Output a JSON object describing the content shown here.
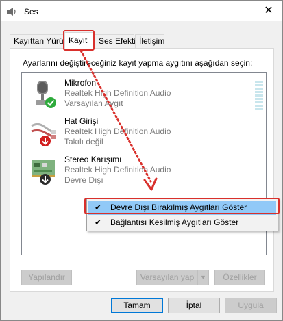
{
  "window": {
    "title": "Ses",
    "close_glyph": "✕"
  },
  "tabs": [
    {
      "label": "Kayıttan Yürüt"
    },
    {
      "label": "Kayıt"
    },
    {
      "label": "Ses Efekti"
    },
    {
      "label": "İletişim"
    }
  ],
  "panel": {
    "instruction": "Ayarlarını değiştireceğiniz kayıt yapma aygıtını aşağıdan seçin:"
  },
  "devices": [
    {
      "name": "Mikrofon",
      "driver": "Realtek High Definition Audio",
      "state": "Varsayılan Aygıt",
      "icon": "microphone-icon",
      "badge": "default-check-badge"
    },
    {
      "name": "Hat Girişi",
      "driver": "Realtek High Definition Audio",
      "state": "Takılı değil",
      "icon": "line-in-cable-icon",
      "badge": "unplugged-arrow-badge"
    },
    {
      "name": "Stereo Karışımı",
      "driver": "Realtek High Definition Audio",
      "state": "Devre Dışı",
      "icon": "sound-card-icon",
      "badge": "disabled-arrow-badge"
    }
  ],
  "context_menu": {
    "items": [
      {
        "label": "Devre Dışı Bırakılmış Aygıtları Göster",
        "checked": true,
        "check_glyph": "✔"
      },
      {
        "label": "Bağlantısı Kesilmiş Aygıtları Göster",
        "checked": true,
        "check_glyph": "✔"
      }
    ]
  },
  "panel_buttons": {
    "configure": "Yapılandır",
    "set_default": "Varsayılan yap",
    "set_default_arrow": "▼",
    "properties": "Özellikler"
  },
  "dialog_buttons": {
    "ok": "Tamam",
    "cancel": "İptal",
    "apply": "Uygula"
  },
  "colors": {
    "highlight_red": "#d9302c",
    "menu_hover": "#91c9f7",
    "accent_blue": "#0078d7",
    "check_green": "#2eaa3c"
  }
}
